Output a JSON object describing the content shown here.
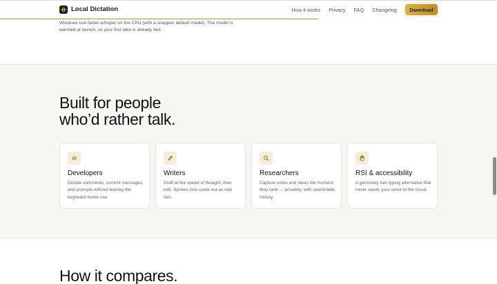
{
  "header": {
    "brand": "Local Dictation",
    "nav": [
      "How it works",
      "Privacy",
      "FAQ",
      "Changelog"
    ],
    "download_label": "Download",
    "read_progress": 0.64
  },
  "top_section": {
    "text": "Windows use faster-whisper on the CPU (with a snappier default model). The model is warmed at launch, so your first take is already fast."
  },
  "features": {
    "heading_line1": "Built for people",
    "heading_line2": "who’d rather talk.",
    "cards": [
      {
        "icon": "code-icon",
        "title": "Developers",
        "desc": "Dictate comments, commit messages, and prompts without leaving the keyboard home row."
      },
      {
        "icon": "pencil-icon",
        "title": "Writers",
        "desc": "Draft at the speed of thought, then edit. Spoken lists come out as real lists."
      },
      {
        "icon": "search-icon",
        "title": "Researchers",
        "desc": "Capture notes and ideas the moment they land — privately, with searchable history."
      },
      {
        "icon": "hand-icon",
        "title": "RSI & accessibility",
        "desc": "A genuinely fast typing alternative that never sends your voice to the cloud."
      }
    ]
  },
  "compare": {
    "heading": "How it compares."
  },
  "colors": {
    "accent": "#c9a23a",
    "page_bg": "#f7f6f3"
  }
}
